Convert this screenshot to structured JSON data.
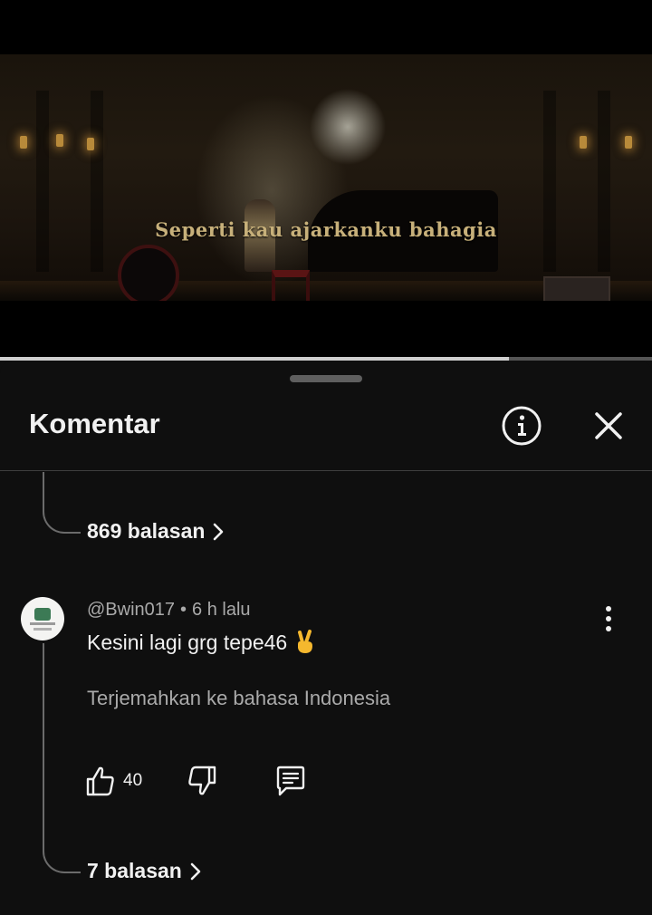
{
  "video": {
    "subtitle": "Seperti kau ajarkanku bahagia",
    "progress": 0.78
  },
  "comments_panel": {
    "title": "Komentar",
    "info_icon": "info-icon",
    "close_icon": "close-icon"
  },
  "previous_thread": {
    "replies_label": "869 balasan"
  },
  "comment": {
    "author": "@Bwin017",
    "separator": "•",
    "time": "6 h lalu",
    "text": "Kesini lagi grg tepe46",
    "emoji": "victory-hand-emoji",
    "translate_label": "Terjemahkan ke bahasa Indonesia",
    "like_count": "40",
    "replies_label": "7 balasan"
  },
  "colors": {
    "background": "#0f0f0f",
    "text_primary": "#f1f1f1",
    "text_secondary": "#aaaaaa",
    "subtitle": "#c7b07a"
  }
}
